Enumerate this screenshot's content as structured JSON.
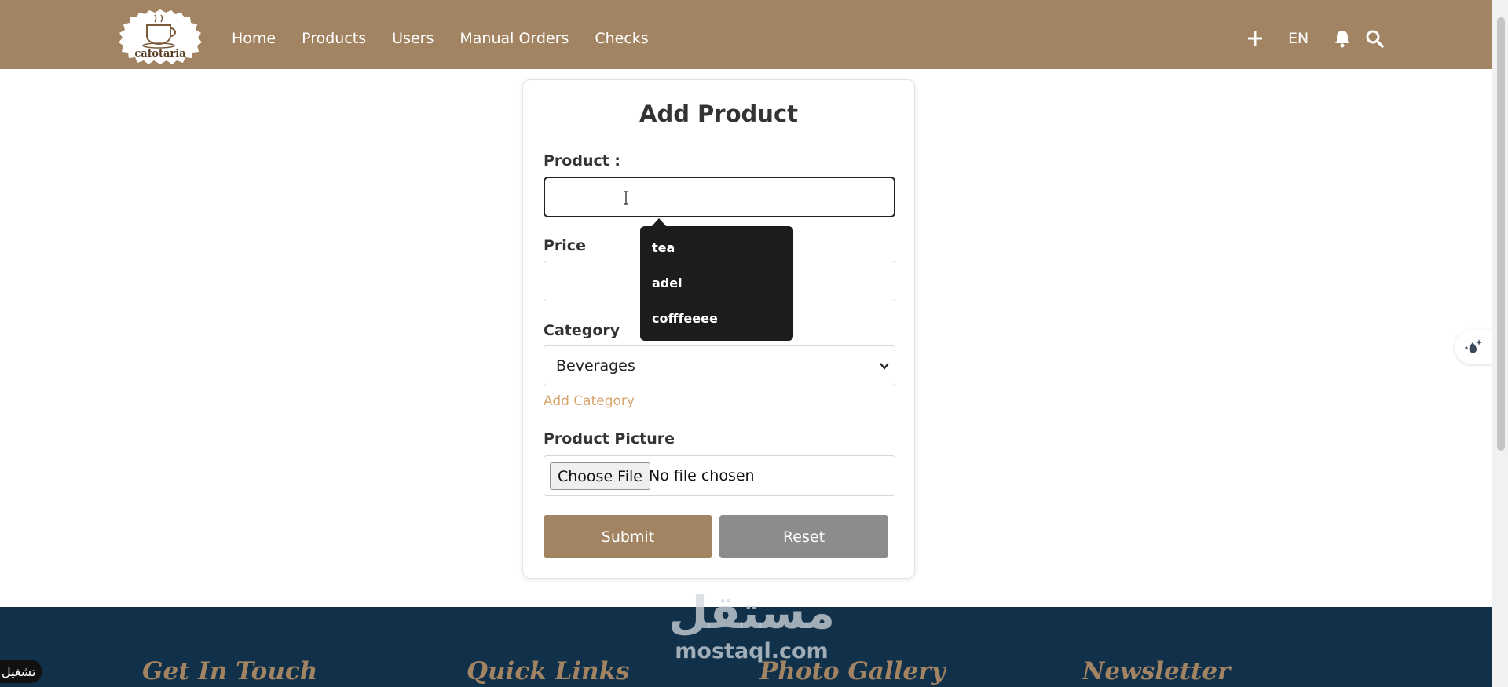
{
  "header": {
    "logo_text": "cafotaria",
    "nav": [
      "Home",
      "Products",
      "Users",
      "Manual Orders",
      "Checks"
    ],
    "lang": "EN"
  },
  "form": {
    "title": "Add Product",
    "product_label": "Product :",
    "product_value": "",
    "price_label": "Price",
    "category_label": "Category",
    "category_selected": "Beverages",
    "add_category_link": "Add Category",
    "picture_label": "Product Picture",
    "file_button": "Choose File",
    "file_status": "No file chosen",
    "submit": "Submit",
    "reset": "Reset"
  },
  "suggestions": [
    "tea",
    "adel",
    "cofffeeee"
  ],
  "footer": {
    "headings": [
      "Get In Touch",
      "Quick Links",
      "Photo Gallery",
      "Newsletter"
    ]
  },
  "watermark": {
    "arabic": "مستقل",
    "url": "mostaql.com"
  },
  "corner_badge": "تشغيل",
  "colors": {
    "brand": "#a28463",
    "footer": "#11304a",
    "link": "#d9a36d",
    "reset": "#8c8c8c"
  }
}
